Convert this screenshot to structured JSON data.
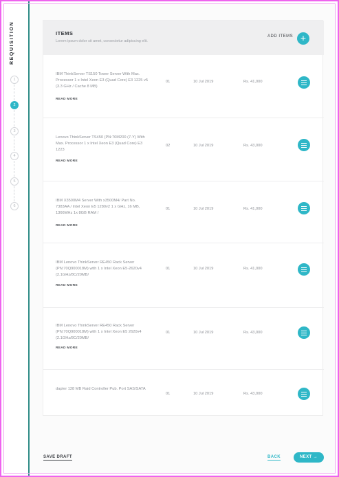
{
  "sidebar": {
    "title": "REQUISITION",
    "steps": [
      "1",
      "2",
      "3",
      "4",
      "5",
      "6"
    ],
    "active_step": 2
  },
  "items_panel": {
    "title": "ITEMS",
    "subtitle": "Lorem ipsum dolor sit amet, consectetur adipiscing elit.",
    "add_label": "ADD ITEMS",
    "add_icon": "plus-icon"
  },
  "rows": [
    {
      "description": "IBM ThinkServer TS150 Tower Server With Max. Processor 1 x Intel Xeon E3 (Quad Core) E3 1225 v5 (3.3 GHz / Cache 8 MB)",
      "read_more": "READ MORE",
      "qty": "01",
      "date": "10 Jul 2019",
      "price": "Rs. 41,000"
    },
    {
      "description": "Lenovo ThinkServer TS450 (PN:70M200 (7-Y) With Max. Processor 1 x Intel Xeon E3 (Quad Core) E3 1223",
      "read_more": "READ MORE",
      "qty": "02",
      "date": "10 Jul 2019",
      "price": "Rs. 43,000"
    },
    {
      "description": "IBM X3500M4 Server With x3500M4/ Part No. 7383AA / Intel Xeon E5 1280v2 1 x GHz, 16 MB, 1366MHz 1x 8GB RAM /",
      "read_more": "READ MORE",
      "qty": "01",
      "date": "10 Jul 2019",
      "price": "Rs. 41,000"
    },
    {
      "description": "IBM Lenovo ThinkServer RE450 Rack Server (PN:70Q900018M) with 1 x Intel Xeon E5-2620v4 (2.1GHz/8C/20MB/",
      "read_more": "READ MORE",
      "qty": "01",
      "date": "10 Jul 2019",
      "price": "Rs. 41,000"
    },
    {
      "description": "IBM Lenovo ThinkServer RE450 Rack Server (PN:70Q900018M) with 1 x Intel Xeon E5 2620v4 (2.1GHz/8C/20MB/",
      "read_more": "READ MORE",
      "qty": "01",
      "date": "10 Jul 2019",
      "price": "Rs. 43,000"
    },
    {
      "description": "dapter 128 MB Raid Controller Pub. Port SAS/SATA",
      "read_more": "",
      "qty": "01",
      "date": "10 Jul 2019",
      "price": "Rs. 43,000"
    }
  ],
  "footer": {
    "save_draft": "SAVE DRAFT",
    "back": "BACK",
    "next": "NEXT →"
  },
  "colors": {
    "accent": "#2fb7c7",
    "rail": "#2e8b86",
    "frame": "#ee63ee"
  }
}
